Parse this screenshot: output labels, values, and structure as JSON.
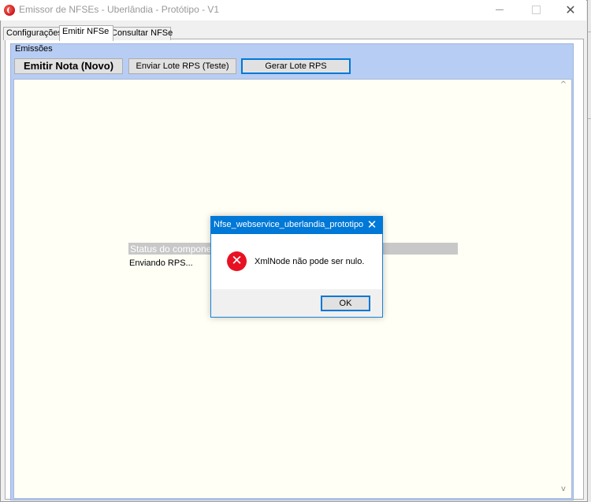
{
  "window": {
    "title": "Emissor de NFSEs - Uberlândia - Protótipo - V1",
    "close_glyph": "✕"
  },
  "tabs": [
    {
      "label": "Configurações",
      "active": false
    },
    {
      "label": "Emitir NFSe",
      "active": true
    },
    {
      "label": "Consultar NFSe",
      "active": false
    }
  ],
  "group": {
    "legend": "Emissões",
    "buttons": {
      "emitir": "Emitir Nota (Novo)",
      "enviar": "Enviar Lote RPS (Teste)",
      "gerar": "Gerar Lote RPS"
    }
  },
  "status": {
    "title": "Status do componen",
    "message": "Enviando RPS..."
  },
  "dialog": {
    "title": "Nfse_webservice_uberlandia_prototipo",
    "message": "XmlNode não pode ser nulo.",
    "ok_label": "OK",
    "icon": "error-icon",
    "close_glyph": "✕"
  },
  "colors": {
    "group_background": "#b7cdf4",
    "dialog_titlebar": "#0078d7",
    "error_icon": "#e81123",
    "textarea_background": "#fffff6"
  }
}
